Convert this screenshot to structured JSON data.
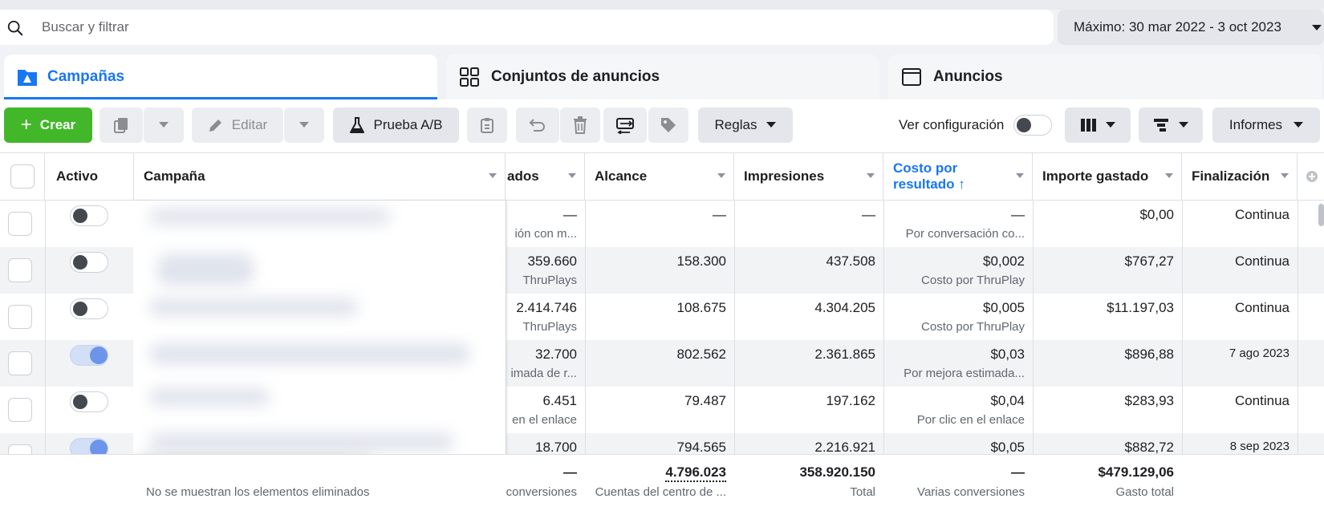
{
  "search": {
    "placeholder": "Buscar y filtrar"
  },
  "date_range": "Máximo: 30 mar 2022 - 3 oct 2023",
  "tabs": [
    {
      "label": "Campañas"
    },
    {
      "label": "Conjuntos de anuncios"
    },
    {
      "label": "Anuncios"
    }
  ],
  "toolbar": {
    "create": "Crear",
    "edit": "Editar",
    "ab_test": "Prueba A/B",
    "rules": "Reglas",
    "view_settings": "Ver configuración",
    "reports": "Informes"
  },
  "columns": {
    "active": "Activo",
    "campaign": "Campaña",
    "results": "ados",
    "reach": "Alcance",
    "impressions": "Impresiones",
    "cost_per_result": "Costo por resultado ↑",
    "amount_spent": "Importe gastado",
    "end": "Finalización"
  },
  "rows": [
    {
      "active": false,
      "results": "—",
      "results_sub": "ión con m...",
      "reach": "—",
      "impressions": "—",
      "cost": "—",
      "cost_sub": "Por conversación co...",
      "spent": "$0,00",
      "end": "Continua"
    },
    {
      "active": false,
      "results": "359.660",
      "results_sub": "ThruPlays",
      "reach": "158.300",
      "impressions": "437.508",
      "cost": "$0,002",
      "cost_sub": "Costo por ThruPlay",
      "spent": "$767,27",
      "end": "Continua"
    },
    {
      "active": false,
      "results": "2.414.746",
      "results_sub": "ThruPlays",
      "reach": "108.675",
      "impressions": "4.304.205",
      "cost": "$0,005",
      "cost_sub": "Costo por ThruPlay",
      "spent": "$11.197,03",
      "end": "Continua"
    },
    {
      "active": true,
      "results": "32.700",
      "results_sub": "imada de r...",
      "reach": "802.562",
      "impressions": "2.361.865",
      "cost": "$0,03",
      "cost_sub": "Por mejora estimada...",
      "spent": "$896,88",
      "end": "7 ago 2023"
    },
    {
      "active": false,
      "results": "6.451",
      "results_sub": "en el enlace",
      "reach": "79.487",
      "impressions": "197.162",
      "cost": "$0,04",
      "cost_sub": "Por clic en el enlace",
      "spent": "$283,93",
      "end": "Continua"
    },
    {
      "active": true,
      "results": "18.700",
      "results_sub": "",
      "reach": "794.565",
      "impressions": "2.216.921",
      "cost": "$0,05",
      "cost_sub": "",
      "spent": "$882,72",
      "end": "8 sep 2023"
    }
  ],
  "footer": {
    "note": "No se muestran los elementos eliminados",
    "results": "—",
    "results_sub": "conversiones",
    "reach": "4.796.023",
    "reach_sub": "Cuentas del centro de ...",
    "impressions": "358.920.150",
    "impressions_sub": "Total",
    "cost": "—",
    "cost_sub": "Varias conversiones",
    "spent": "$479.129,06",
    "spent_sub": "Gasto total"
  },
  "colors": {
    "accent": "#1877f2",
    "create": "#42b72a"
  }
}
